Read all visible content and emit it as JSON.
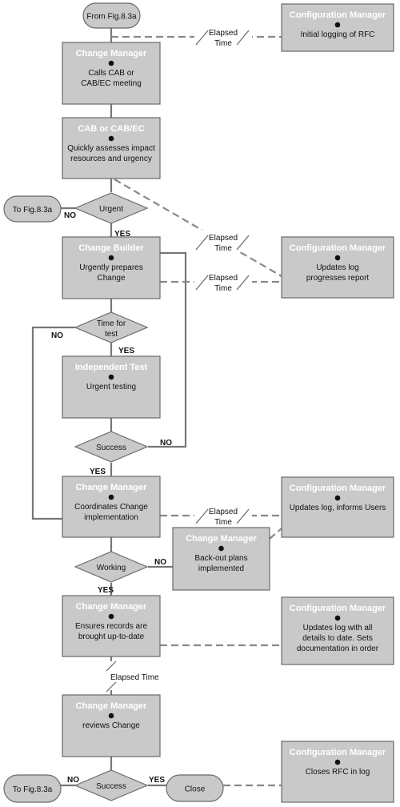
{
  "nodes": {
    "start": {
      "type": "terminator",
      "text": "From Fig.8.3a"
    },
    "cm1": {
      "type": "process",
      "title": "Change Manager",
      "body": [
        "Calls CAB or",
        "CAB/EC meeting"
      ]
    },
    "cab": {
      "type": "process",
      "title": "CAB or CAB/EC",
      "body": [
        "Quickly assesses impact",
        "resources and urgency"
      ]
    },
    "urgent": {
      "type": "decision",
      "text": [
        "Urgent"
      ]
    },
    "tofig1": {
      "type": "terminator",
      "text": "To Fig.8.3a"
    },
    "builder": {
      "type": "process",
      "title": "Change Builder",
      "body": [
        "Urgently prepares",
        "Change"
      ]
    },
    "timetest": {
      "type": "decision",
      "text": [
        "Time for",
        "test"
      ]
    },
    "indtest": {
      "type": "process",
      "title": "Independent Test",
      "body": [
        "Urgent testing"
      ]
    },
    "success1": {
      "type": "decision",
      "text": [
        "Success"
      ]
    },
    "cm3": {
      "type": "process",
      "title": "Change Manager",
      "body": [
        "Coordinates Change",
        "implementation"
      ]
    },
    "backout": {
      "type": "process",
      "title": "Change Manager",
      "body": [
        "Back-out plans",
        "implemented"
      ]
    },
    "working": {
      "type": "decision",
      "text": [
        "Working"
      ]
    },
    "cm4": {
      "type": "process",
      "title": "Change Manager",
      "body": [
        "Ensures records are",
        "brought up-to-date"
      ]
    },
    "cm5": {
      "type": "process",
      "title": "Change Manager",
      "body": [
        "reviews Change"
      ]
    },
    "success2": {
      "type": "decision",
      "text": [
        "Success"
      ]
    },
    "tofig2": {
      "type": "terminator",
      "text": "To Fig.8.3a"
    },
    "close": {
      "type": "terminator",
      "text": "Close"
    },
    "cfg1": {
      "type": "process",
      "title": "Configuration Manager",
      "body": [
        "Initial logging of RFC"
      ]
    },
    "cfg2": {
      "type": "process",
      "title": "Configuration Manager",
      "body": [
        "Updates log",
        "progresses report"
      ]
    },
    "cfg3": {
      "type": "process",
      "title": "Configuration Manager",
      "body": [
        "Updates log, informs Users"
      ]
    },
    "cfg4": {
      "type": "process",
      "title": "Configuration Manager",
      "body": [
        "Updates log with all",
        "details to date. Sets",
        "documentation in order"
      ]
    },
    "cfg5": {
      "type": "process",
      "title": "Configuration Manager",
      "body": [
        "Closes RFC in log"
      ]
    }
  },
  "labels": {
    "yes": "YES",
    "no": "NO",
    "elapsed_line1": "Elapsed",
    "elapsed_line2": "Time",
    "elapsed_time": "Elapsed Time"
  },
  "colors": {
    "box_fill": "#c9c9c9",
    "box_stroke": "#6a6a6a",
    "title_text": "#ffffff"
  }
}
